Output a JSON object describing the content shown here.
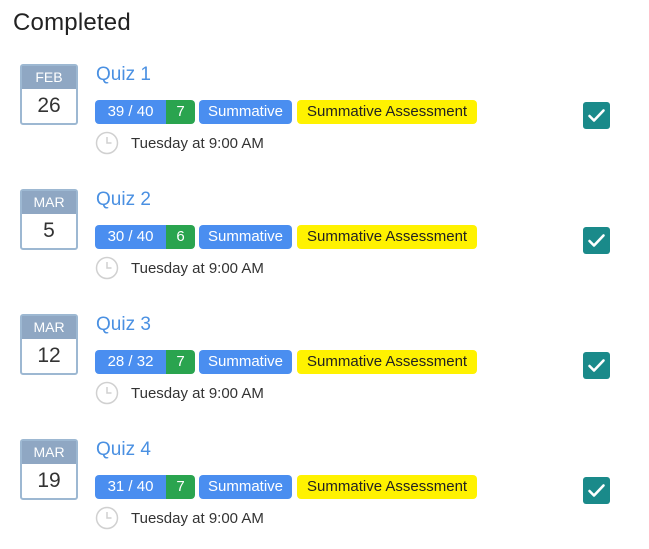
{
  "section": {
    "title": "Completed"
  },
  "items": [
    {
      "month": "FEB",
      "day": "26",
      "title": "Quiz 1",
      "score": "39 / 40",
      "count": "7",
      "type": "Summative",
      "assessment": "Summative Assessment",
      "time": "Tuesday at 9:00 AM",
      "completed": true
    },
    {
      "month": "MAR",
      "day": "5",
      "title": "Quiz 2",
      "score": "30 / 40",
      "count": "6",
      "type": "Summative",
      "assessment": "Summative Assessment",
      "time": "Tuesday at 9:00 AM",
      "completed": true
    },
    {
      "month": "MAR",
      "day": "12",
      "title": "Quiz 3",
      "score": "28 / 32",
      "count": "7",
      "type": "Summative",
      "assessment": "Summative Assessment",
      "time": "Tuesday at 9:00 AM",
      "completed": true
    },
    {
      "month": "MAR",
      "day": "19",
      "title": "Quiz 4",
      "score": "31 / 40",
      "count": "7",
      "type": "Summative",
      "assessment": "Summative Assessment",
      "time": "Tuesday at 9:00 AM",
      "completed": true
    }
  ],
  "icons": {
    "clock": "clock-icon",
    "check": "check-icon"
  },
  "colors": {
    "link": "#4a90e2",
    "score_badge": "#4a8ef0",
    "count_badge": "#2aa44f",
    "assessment_badge": "#fff200",
    "checkbox": "#1a8a8a",
    "calendar_header": "#8fa7c3"
  }
}
